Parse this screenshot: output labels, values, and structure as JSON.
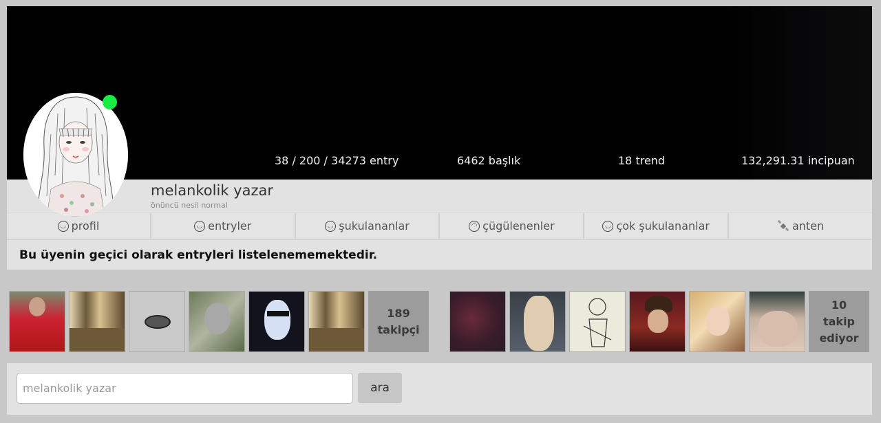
{
  "stats": {
    "entries": "38 / 200 / 34273 entry",
    "topics": "6462 başlık",
    "trends": "18 trend",
    "points": "132,291.31 incipuan"
  },
  "user": {
    "name": "melankolik yazar",
    "subtitle": "önüncü nesil normal",
    "online_color": "#17ee44"
  },
  "tabs": [
    {
      "icon": "cool-smiley-icon",
      "label": "profil"
    },
    {
      "icon": "smiley-icon",
      "label": "entryler"
    },
    {
      "icon": "smiley-icon",
      "label": "şukulananlar"
    },
    {
      "icon": "frown-icon",
      "label": "çügülenenler"
    },
    {
      "icon": "grin-icon",
      "label": "çok şukulananlar"
    },
    {
      "icon": "satellite-icon",
      "label": "anten"
    }
  ],
  "notice": "Bu üyenin geçici olarak entryleri listelenememektedir.",
  "followers": {
    "count": "189",
    "label": "takipçi"
  },
  "following": {
    "count": "10",
    "label_line1": "takip",
    "label_line2": "ediyor"
  },
  "search": {
    "placeholder": "melankolik yazar",
    "button_label": "ara"
  }
}
